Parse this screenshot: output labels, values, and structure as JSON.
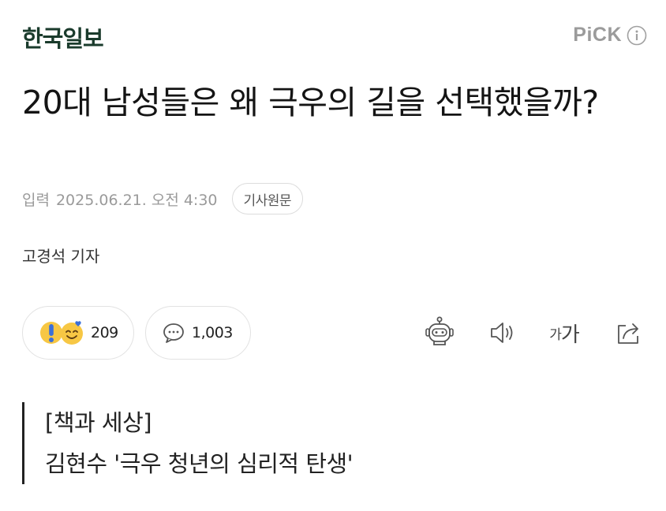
{
  "header": {
    "brand": "한국일보",
    "pick_label": "PiCK",
    "pick_info_icon": "info-icon"
  },
  "article": {
    "headline": "20대 남성들은 왜 극우의 길을 선택했을까?",
    "published_label": "입력",
    "published_datetime": "2025.06.21. 오전 4:30",
    "original_link": "기사원문",
    "reporter": "고경석 기자"
  },
  "engagement": {
    "reactions_count": "209",
    "reaction_icons": [
      "exclamation-icon",
      "smiling-face-heart-icon"
    ],
    "comments_icon": "speech-bubble-icon",
    "comments_count": "1,003"
  },
  "toolbar": {
    "summary_bot_icon": "robot-icon",
    "tts_icon": "speaker-icon",
    "font_size_small": "가",
    "font_size_large": "가",
    "share_icon": "share-icon"
  },
  "subtitle": {
    "line1": "[책과 세상]",
    "line2": "김현수 '극우 청년의 심리적 탄생'"
  },
  "colors": {
    "brand": "#1a3b2c",
    "pick": "#9b9b9b",
    "meta": "#9a9a9a",
    "emoji_yellow": "#f7c744",
    "emoji_blue": "#3b6fd8"
  }
}
